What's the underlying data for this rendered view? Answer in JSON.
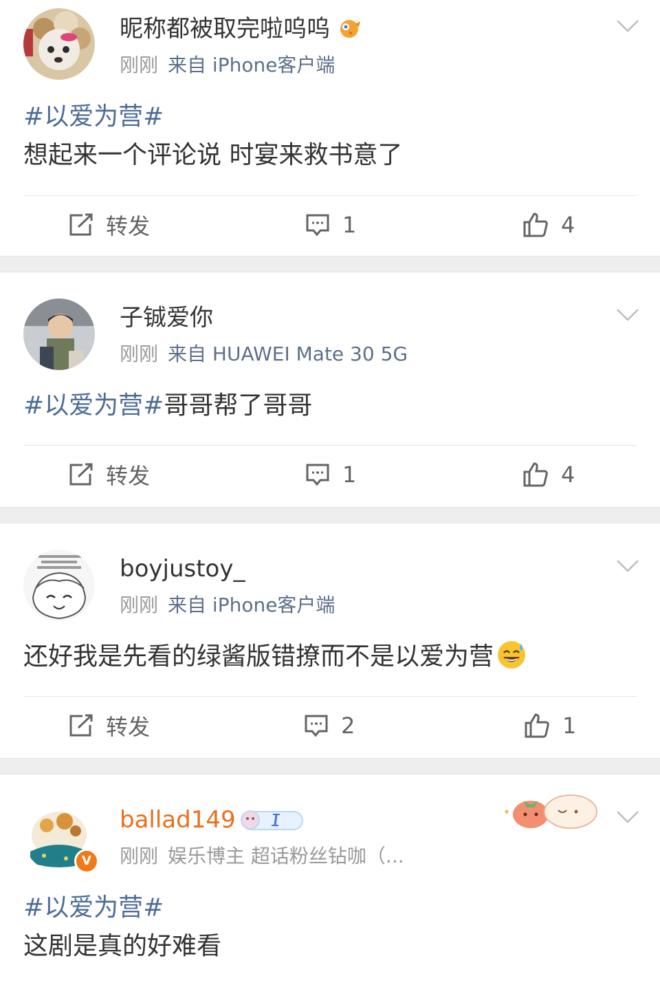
{
  "posts": [
    {
      "nickname": "昵称都被取完啦呜呜",
      "time": "刚刚",
      "source": "来自 iPhone客户端",
      "topic": "#以爱为营#",
      "text": "想起来一个评论说 时宴来救书意了",
      "actions": {
        "repost": "转发",
        "comments": "1",
        "likes": "4"
      }
    },
    {
      "nickname": "子铖爱你",
      "time": "刚刚",
      "source": "来自 HUAWEI Mate 30 5G",
      "topic": "#以爱为营#",
      "text": "哥哥帮了哥哥",
      "actions": {
        "repost": "转发",
        "comments": "1",
        "likes": "4"
      }
    },
    {
      "nickname": "boyjustoy_",
      "time": "刚刚",
      "source": "来自 iPhone客户端",
      "text": "还好我是先看的绿酱版错撩而不是以爱为营",
      "actions": {
        "repost": "转发",
        "comments": "2",
        "likes": "1"
      }
    },
    {
      "nickname": "ballad149",
      "time": "刚刚",
      "source": "娱乐博主 超话粉丝钻咖（...",
      "topic": "#以爱为营#",
      "text": "这剧是真的好难看",
      "verified_badge": "V"
    }
  ],
  "colors": {
    "topic": "#4d6c96",
    "source": "#5d6f8a",
    "vip_name": "#ea6f1a",
    "separator": "#eeeeee"
  },
  "icons": [
    "share-icon",
    "comment-icon",
    "like-icon",
    "chevron-down-icon"
  ]
}
